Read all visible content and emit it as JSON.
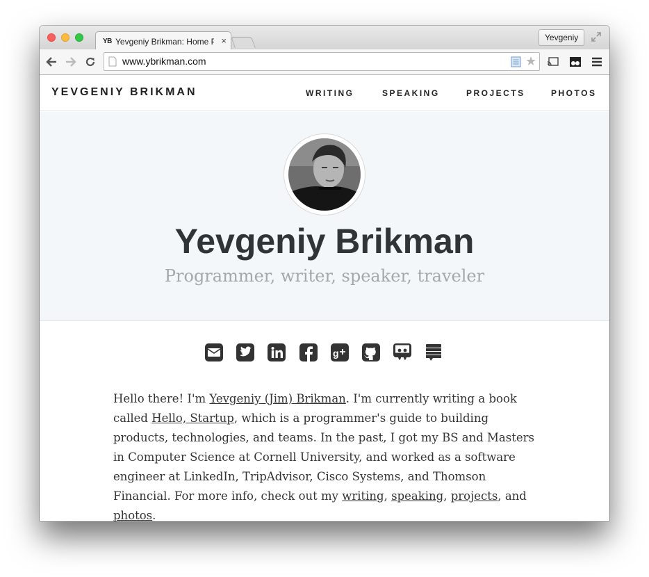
{
  "browser": {
    "tab_favicon": "YB",
    "tab_title": "Yevgeniy Brikman: Home P",
    "tab_close": "×",
    "profile_name": "Yevgeniy",
    "url": "www.ybrikman.com"
  },
  "site": {
    "brand": "YEVGENIY BRIKMAN",
    "nav": [
      "WRITING",
      "SPEAKING",
      "PROJECTS",
      "PHOTOS"
    ]
  },
  "hero": {
    "name": "Yevgeniy Brikman",
    "tagline": "Programmer, writer, speaker, traveler"
  },
  "social_icons": [
    "email-icon",
    "twitter-icon",
    "linkedin-icon",
    "facebook-icon",
    "google-plus-icon",
    "github-icon",
    "slideshare-icon",
    "stack-icon"
  ],
  "bio": {
    "t1": "Hello there! I'm ",
    "name_link": "Yevgeniy (Jim) Brikman",
    "t2": ". I'm currently writing a book called ",
    "book_link": "Hello, Startup",
    "t3": ", which is a programmer's guide to building products, technologies, and teams. In the past, I got my BS and Masters in Computer Science at Cornell University, and worked as a software engineer at LinkedIn, TripAdvisor, Cisco Systems, and Thomson Financial. For more info, check out my ",
    "writing_link": "writing",
    "sep1": ", ",
    "speaking_link": "speaking",
    "sep2": ", ",
    "projects_link": "projects",
    "t4": ", and ",
    "photos_link": "photos",
    "t5": "."
  },
  "colors": {
    "hero_bg": "#f4f7f9",
    "icon_color": "#333333",
    "name_color": "#2f3438",
    "tagline_color": "#a2a8ac"
  }
}
